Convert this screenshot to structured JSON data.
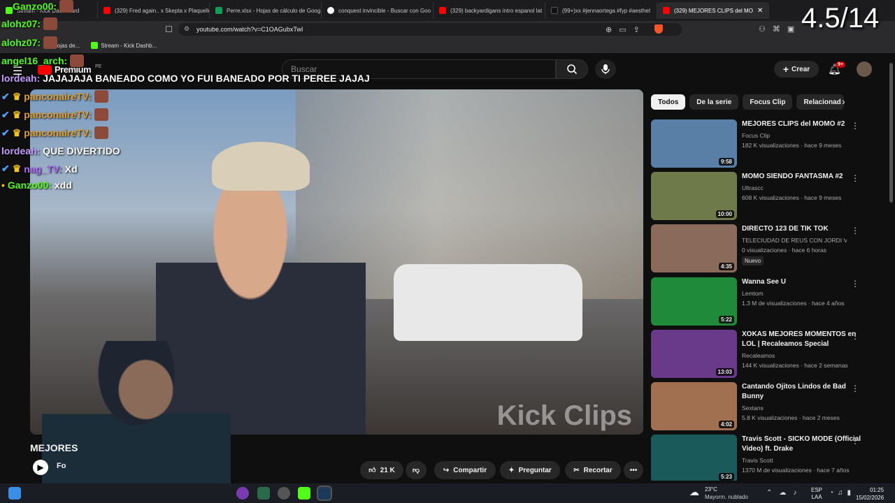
{
  "browser": {
    "tabs": [
      {
        "label": "Stream - Kick Dashboard",
        "color": "#53fc18"
      },
      {
        "label": "(329) Fred again.. x Skepta x Plaquelle",
        "color": "#ff0000"
      },
      {
        "label": "Perre.xlsx - Hojas de cálculo de Goog",
        "color": "#0f9d58"
      },
      {
        "label": "conquest invincible - Buscar con Goo",
        "color": "#ffffff"
      },
      {
        "label": "(329) backyardigans intro espanol lat",
        "color": "#ff0000"
      },
      {
        "label": "(99+)xx #jennaortega #fyp #aesthet",
        "color": "#111111"
      },
      {
        "label": "(329) MEJORES CLIPS del MO",
        "color": "#ff0000"
      }
    ],
    "url": "youtube.com/watch?v=C1OAGubxTwI",
    "bookmarks": [
      "Hojas de...",
      "Stream - Kick Dashb..."
    ]
  },
  "overlay_counter": "4.5/14",
  "youtube": {
    "search_placeholder": "Buscar",
    "create_label": "Crear",
    "notif_count": "9+",
    "logo_text": "Premium",
    "country_code": "PE"
  },
  "chat": [
    {
      "user": "Ganzo00:",
      "text": "",
      "color": "#53fc18"
    },
    {
      "user": "alohz07:",
      "text": "",
      "color": "#53fc18"
    },
    {
      "user": "alohz07:",
      "text": "",
      "color": "#53fc18"
    },
    {
      "user": "angel16_arch:",
      "text": "",
      "color": "#53fc18"
    },
    {
      "user": "lordeah:",
      "text": "JAJAJAJA BANEADO COMO YO FUI BANEADO POR TI PEREE JAJAJ",
      "color": "#c79bff"
    },
    {
      "user": "panconaireTV:",
      "text": "",
      "color": "#e0a030"
    },
    {
      "user": "panconaireTV:",
      "text": "",
      "color": "#e0a030"
    },
    {
      "user": "panconaireTV:",
      "text": "",
      "color": "#e0a030"
    },
    {
      "user": "lordeah:",
      "text": "QUE DIVERTIDO",
      "color": "#c79bff"
    },
    {
      "user": "nag_TV:",
      "text": "Xd",
      "color": "#b06bff"
    },
    {
      "user": "Ganzo00:",
      "text": "xdd",
      "color": "#53fc18"
    }
  ],
  "video": {
    "watermark": "Kick Clips",
    "title_partial": "MEJORES",
    "channel_partial": "Fo"
  },
  "actions": {
    "likes": "21 K",
    "share": "Compartir",
    "ask": "Preguntar",
    "clip": "Recortar"
  },
  "chips": [
    "Todos",
    "De la serie",
    "Focus Clip",
    "Relacionad"
  ],
  "recommendations": [
    {
      "title": "MEJORES CLIPS del MOMO #2",
      "channel": "Focus Clip",
      "meta": "182 K visualizaciones · hace 9 meses",
      "duration": "9:58",
      "thumb": "#5a7fa6",
      "badge": ""
    },
    {
      "title": "MOMO SIENDO FANTASMA #2",
      "channel": "Ultrascc",
      "meta": "608 K visualizaciones · hace 9 meses",
      "duration": "10:00",
      "thumb": "#6e7a4a",
      "badge": ""
    },
    {
      "title": "DIRECTO 123 DE TIK TOK",
      "channel": "TELECIUDAD DE REUS CON JORDI VILL...",
      "meta": "0 visualizaciones · hace 6 horas",
      "duration": "4:35",
      "thumb": "#8a6a5a",
      "badge": "Nuevo"
    },
    {
      "title": "Wanna See U",
      "channel": "Lemtom",
      "meta": "1,3 M de visualizaciones · hace 4 años",
      "duration": "5:22",
      "thumb": "#1e8a3a",
      "badge": ""
    },
    {
      "title": "XOKAS MEJORES MOMENTOS en LOL | Recaleamos Special",
      "channel": "Recaleamos",
      "meta": "144 K visualizaciones · hace 2 semanas",
      "duration": "13:03",
      "thumb": "#6a3a8a",
      "badge": ""
    },
    {
      "title": "Cantando Ojitos Lindos de Bad Bunny",
      "channel": "Sextans",
      "meta": "5,8 K visualizaciones · hace 2 meses",
      "duration": "4:02",
      "thumb": "#a07050",
      "badge": ""
    },
    {
      "title": "Travis Scott - SICKO MODE (Official Video) ft. Drake",
      "channel": "Travis Scott",
      "meta": "1370 M de visualizaciones · hace 7 años",
      "duration": "5:23",
      "thumb": "#1a5a5a",
      "badge": ""
    }
  ],
  "taskbar": {
    "weather_temp": "23°C",
    "weather_desc": "Mayorm. nublado",
    "lang": "ESP",
    "lang2": "LAA",
    "time": "01:25",
    "date": "15/02/2026"
  }
}
